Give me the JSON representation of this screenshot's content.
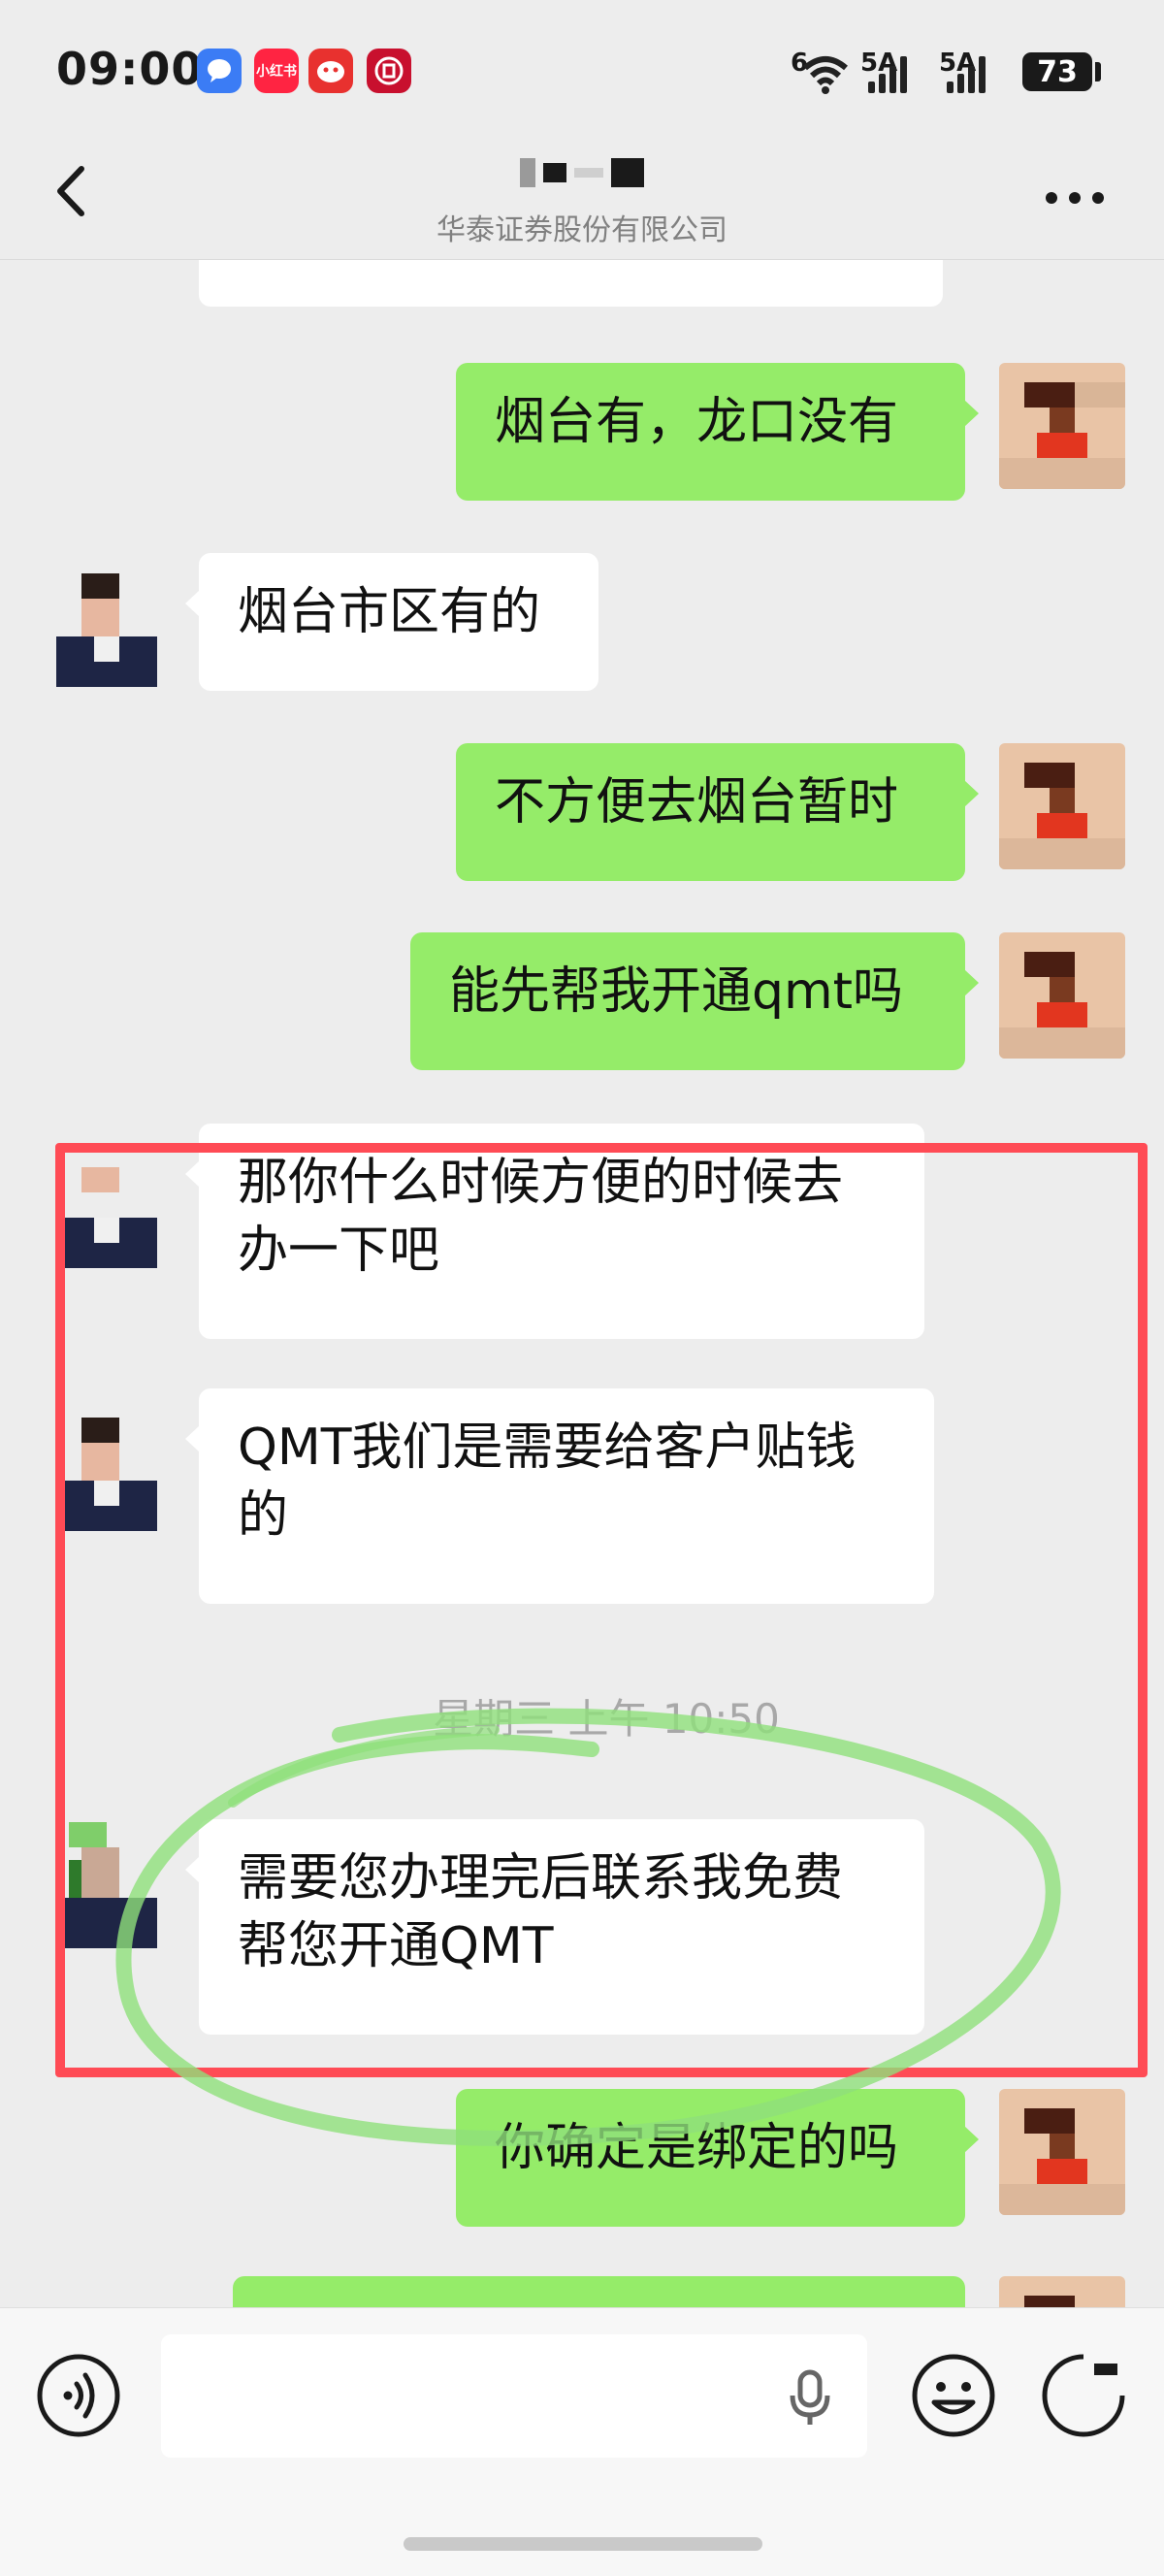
{
  "status_bar": {
    "time": "09:00",
    "app_icons": [
      "message-app-icon",
      "xiaohongshu-icon",
      "assistant-app-icon",
      "bank-app-icon"
    ],
    "app_icon_labels": [
      "",
      "小红书",
      "",
      ""
    ],
    "network_labels": [
      "6",
      "5A",
      "5A"
    ],
    "battery": "73"
  },
  "header": {
    "company": "华泰证券股份有限公司",
    "back_icon": "back-chevron-icon",
    "more_icon": "more-dots-icon"
  },
  "messages": [
    {
      "from": "sender",
      "text": ""
    },
    {
      "from": "me",
      "text": "烟台有，龙口没有"
    },
    {
      "from": "sender",
      "text": "烟台市区有的"
    },
    {
      "from": "me",
      "text": "不方便去烟台暂时"
    },
    {
      "from": "me",
      "text": "能先帮我开通qmt吗"
    },
    {
      "from": "sender",
      "text": "那你什么时候方便的时候去办一下吧"
    },
    {
      "from": "sender",
      "text": "QMT我们是需要给客户贴钱的"
    },
    {
      "from": "sender",
      "text": "需要您办理完后联系我免费帮您开通QMT"
    },
    {
      "from": "me",
      "text": "你确定是绑定的吗"
    },
    {
      "from": "me",
      "text": ""
    }
  ],
  "timestamp": "星期三 上午 10:50",
  "annotations": {
    "frame_color": "#ff4b55",
    "circle_color": "#8fe07a"
  },
  "input_bar": {
    "placeholder": "",
    "icons": [
      "voice-icon",
      "mic-icon",
      "emoji-icon",
      "plus-icon"
    ]
  },
  "colors": {
    "background": "#ededed",
    "incoming_bubble": "#ffffff",
    "outgoing_bubble": "#95ec69"
  }
}
